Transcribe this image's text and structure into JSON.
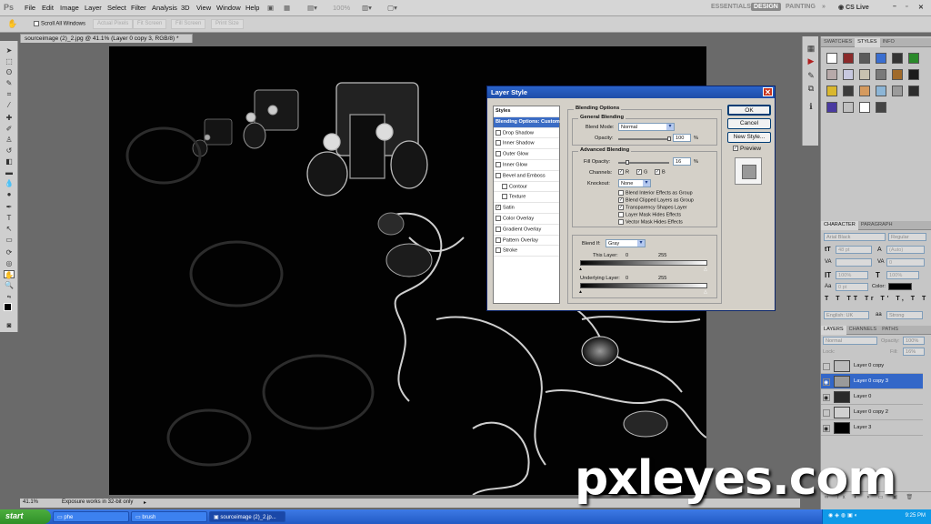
{
  "menubar": {
    "logo": "Ps",
    "items": [
      "File",
      "Edit",
      "Image",
      "Layer",
      "Select",
      "Filter",
      "Analysis",
      "3D",
      "View",
      "Window",
      "Help"
    ],
    "zoom": "100%",
    "workspaces": [
      "ESSENTIALS",
      "DESIGN",
      "PAINTING"
    ],
    "more": "»",
    "cs_live": "CS Live"
  },
  "options_bar": {
    "scroll_all_label": "Scroll All Windows",
    "buttons": [
      "Actual Pixels",
      "Fit Screen",
      "Fill Screen",
      "Print Size"
    ]
  },
  "document": {
    "tab_title": "sourceimage (2)_2.jpg @ 41.1% (Layer 0 copy 3, RGB/8) *",
    "zoom": "41.1%",
    "status": "Exposure works in 32-bit only"
  },
  "dialog": {
    "title": "Layer Style",
    "styles_header": "Styles",
    "styles": [
      {
        "label": "Blending Options: Custom",
        "checked": null,
        "selected": true,
        "indent": false
      },
      {
        "label": "Drop Shadow",
        "checked": false,
        "selected": false,
        "indent": false
      },
      {
        "label": "Inner Shadow",
        "checked": false,
        "selected": false,
        "indent": false
      },
      {
        "label": "Outer Glow",
        "checked": false,
        "selected": false,
        "indent": false
      },
      {
        "label": "Inner Glow",
        "checked": false,
        "selected": false,
        "indent": false
      },
      {
        "label": "Bevel and Emboss",
        "checked": false,
        "selected": false,
        "indent": false
      },
      {
        "label": "Contour",
        "checked": false,
        "selected": false,
        "indent": true
      },
      {
        "label": "Texture",
        "checked": false,
        "selected": false,
        "indent": true
      },
      {
        "label": "Satin",
        "checked": true,
        "selected": false,
        "indent": false
      },
      {
        "label": "Color Overlay",
        "checked": false,
        "selected": false,
        "indent": false
      },
      {
        "label": "Gradient Overlay",
        "checked": false,
        "selected": false,
        "indent": false
      },
      {
        "label": "Pattern Overlay",
        "checked": false,
        "selected": false,
        "indent": false
      },
      {
        "label": "Stroke",
        "checked": false,
        "selected": false,
        "indent": false
      }
    ],
    "blending_options": "Blending Options",
    "general_blending": "General Blending",
    "blend_mode_label": "Blend Mode:",
    "blend_mode": "Normal",
    "opacity_label": "Opacity:",
    "opacity": "100",
    "percent": "%",
    "advanced_blending": "Advanced Blending",
    "fill_opacity_label": "Fill Opacity:",
    "fill_opacity": "16",
    "channels_label": "Channels:",
    "channels": [
      "R",
      "G",
      "B"
    ],
    "knockout_label": "Knockout:",
    "knockout": "None",
    "adv_checks": [
      {
        "label": "Blend Interior Effects as Group",
        "checked": false
      },
      {
        "label": "Blend Clipped Layers as Group",
        "checked": true
      },
      {
        "label": "Transparency Shapes Layer",
        "checked": true
      },
      {
        "label": "Layer Mask Hides Effects",
        "checked": false
      },
      {
        "label": "Vector Mask Hides Effects",
        "checked": false
      }
    ],
    "blend_if_label": "Blend If:",
    "blend_if": "Gray",
    "this_layer_label": "This Layer:",
    "this_layer_min": "0",
    "this_layer_max": "255",
    "underlying_label": "Underlying Layer:",
    "underlying_min": "0",
    "underlying_max": "255",
    "ok": "OK",
    "cancel": "Cancel",
    "new_style": "New Style...",
    "preview_label": "Preview",
    "preview_checked": true
  },
  "panels": {
    "swatch_tabs": [
      "SWATCHES",
      "STYLES",
      "INFO"
    ],
    "character_tabs": [
      "CHARACTER",
      "PARAGRAPH"
    ],
    "font": "Arial Black",
    "font_style": "Regular",
    "font_size": "48 pt",
    "leading": "(Auto)",
    "tracking": "0",
    "scale_v": "100%",
    "scale_h": "100%",
    "baseline": "0 pt",
    "color_label": "Color:",
    "language": "English: UK",
    "aa": "Strong",
    "layers_tabs": [
      "LAYERS",
      "CHANNELS",
      "PATHS"
    ],
    "blend_mode": "Normal",
    "opacity_label": "Opacity:",
    "opacity": "100%",
    "fill_label": "Fill:",
    "fill": "16%",
    "lock_label": "Lock:",
    "layers": [
      {
        "name": "Layer 0 copy",
        "visible": false,
        "active": false,
        "thumb": "#bcbcbc"
      },
      {
        "name": "Layer 0 copy 3",
        "visible": true,
        "active": true,
        "thumb": "#9a9a9a"
      },
      {
        "name": "Layer 0",
        "visible": true,
        "active": false,
        "thumb": "#2a2a2a"
      },
      {
        "name": "Layer 0 copy 2",
        "visible": false,
        "active": false,
        "thumb": "#d0d0d0"
      },
      {
        "name": "Layer 3",
        "visible": true,
        "active": false,
        "thumb": "#000000"
      }
    ]
  },
  "taskbar": {
    "start": "start",
    "tasks": [
      "phe",
      "brush",
      "sourceimage (2)_2.jp..."
    ],
    "time": "9:25 PM"
  },
  "watermark": "pxleyes.com"
}
